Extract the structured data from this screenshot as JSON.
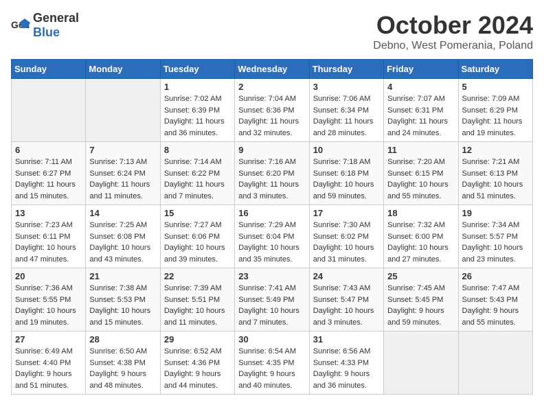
{
  "logo": {
    "general": "General",
    "blue": "Blue"
  },
  "title": "October 2024",
  "location": "Debno, West Pomerania, Poland",
  "days_of_week": [
    "Sunday",
    "Monday",
    "Tuesday",
    "Wednesday",
    "Thursday",
    "Friday",
    "Saturday"
  ],
  "weeks": [
    [
      {
        "day": "",
        "empty": true
      },
      {
        "day": "",
        "empty": true
      },
      {
        "day": "1",
        "sunrise": "Sunrise: 7:02 AM",
        "sunset": "Sunset: 6:39 PM",
        "daylight": "Daylight: 11 hours and 36 minutes."
      },
      {
        "day": "2",
        "sunrise": "Sunrise: 7:04 AM",
        "sunset": "Sunset: 6:36 PM",
        "daylight": "Daylight: 11 hours and 32 minutes."
      },
      {
        "day": "3",
        "sunrise": "Sunrise: 7:06 AM",
        "sunset": "Sunset: 6:34 PM",
        "daylight": "Daylight: 11 hours and 28 minutes."
      },
      {
        "day": "4",
        "sunrise": "Sunrise: 7:07 AM",
        "sunset": "Sunset: 6:31 PM",
        "daylight": "Daylight: 11 hours and 24 minutes."
      },
      {
        "day": "5",
        "sunrise": "Sunrise: 7:09 AM",
        "sunset": "Sunset: 6:29 PM",
        "daylight": "Daylight: 11 hours and 19 minutes."
      }
    ],
    [
      {
        "day": "6",
        "sunrise": "Sunrise: 7:11 AM",
        "sunset": "Sunset: 6:27 PM",
        "daylight": "Daylight: 11 hours and 15 minutes."
      },
      {
        "day": "7",
        "sunrise": "Sunrise: 7:13 AM",
        "sunset": "Sunset: 6:24 PM",
        "daylight": "Daylight: 11 hours and 11 minutes."
      },
      {
        "day": "8",
        "sunrise": "Sunrise: 7:14 AM",
        "sunset": "Sunset: 6:22 PM",
        "daylight": "Daylight: 11 hours and 7 minutes."
      },
      {
        "day": "9",
        "sunrise": "Sunrise: 7:16 AM",
        "sunset": "Sunset: 6:20 PM",
        "daylight": "Daylight: 11 hours and 3 minutes."
      },
      {
        "day": "10",
        "sunrise": "Sunrise: 7:18 AM",
        "sunset": "Sunset: 6:18 PM",
        "daylight": "Daylight: 10 hours and 59 minutes."
      },
      {
        "day": "11",
        "sunrise": "Sunrise: 7:20 AM",
        "sunset": "Sunset: 6:15 PM",
        "daylight": "Daylight: 10 hours and 55 minutes."
      },
      {
        "day": "12",
        "sunrise": "Sunrise: 7:21 AM",
        "sunset": "Sunset: 6:13 PM",
        "daylight": "Daylight: 10 hours and 51 minutes."
      }
    ],
    [
      {
        "day": "13",
        "sunrise": "Sunrise: 7:23 AM",
        "sunset": "Sunset: 6:11 PM",
        "daylight": "Daylight: 10 hours and 47 minutes."
      },
      {
        "day": "14",
        "sunrise": "Sunrise: 7:25 AM",
        "sunset": "Sunset: 6:08 PM",
        "daylight": "Daylight: 10 hours and 43 minutes."
      },
      {
        "day": "15",
        "sunrise": "Sunrise: 7:27 AM",
        "sunset": "Sunset: 6:06 PM",
        "daylight": "Daylight: 10 hours and 39 minutes."
      },
      {
        "day": "16",
        "sunrise": "Sunrise: 7:29 AM",
        "sunset": "Sunset: 6:04 PM",
        "daylight": "Daylight: 10 hours and 35 minutes."
      },
      {
        "day": "17",
        "sunrise": "Sunrise: 7:30 AM",
        "sunset": "Sunset: 6:02 PM",
        "daylight": "Daylight: 10 hours and 31 minutes."
      },
      {
        "day": "18",
        "sunrise": "Sunrise: 7:32 AM",
        "sunset": "Sunset: 6:00 PM",
        "daylight": "Daylight: 10 hours and 27 minutes."
      },
      {
        "day": "19",
        "sunrise": "Sunrise: 7:34 AM",
        "sunset": "Sunset: 5:57 PM",
        "daylight": "Daylight: 10 hours and 23 minutes."
      }
    ],
    [
      {
        "day": "20",
        "sunrise": "Sunrise: 7:36 AM",
        "sunset": "Sunset: 5:55 PM",
        "daylight": "Daylight: 10 hours and 19 minutes."
      },
      {
        "day": "21",
        "sunrise": "Sunrise: 7:38 AM",
        "sunset": "Sunset: 5:53 PM",
        "daylight": "Daylight: 10 hours and 15 minutes."
      },
      {
        "day": "22",
        "sunrise": "Sunrise: 7:39 AM",
        "sunset": "Sunset: 5:51 PM",
        "daylight": "Daylight: 10 hours and 11 minutes."
      },
      {
        "day": "23",
        "sunrise": "Sunrise: 7:41 AM",
        "sunset": "Sunset: 5:49 PM",
        "daylight": "Daylight: 10 hours and 7 minutes."
      },
      {
        "day": "24",
        "sunrise": "Sunrise: 7:43 AM",
        "sunset": "Sunset: 5:47 PM",
        "daylight": "Daylight: 10 hours and 3 minutes."
      },
      {
        "day": "25",
        "sunrise": "Sunrise: 7:45 AM",
        "sunset": "Sunset: 5:45 PM",
        "daylight": "Daylight: 9 hours and 59 minutes."
      },
      {
        "day": "26",
        "sunrise": "Sunrise: 7:47 AM",
        "sunset": "Sunset: 5:43 PM",
        "daylight": "Daylight: 9 hours and 55 minutes."
      }
    ],
    [
      {
        "day": "27",
        "sunrise": "Sunrise: 6:49 AM",
        "sunset": "Sunset: 4:40 PM",
        "daylight": "Daylight: 9 hours and 51 minutes."
      },
      {
        "day": "28",
        "sunrise": "Sunrise: 6:50 AM",
        "sunset": "Sunset: 4:38 PM",
        "daylight": "Daylight: 9 hours and 48 minutes."
      },
      {
        "day": "29",
        "sunrise": "Sunrise: 6:52 AM",
        "sunset": "Sunset: 4:36 PM",
        "daylight": "Daylight: 9 hours and 44 minutes."
      },
      {
        "day": "30",
        "sunrise": "Sunrise: 6:54 AM",
        "sunset": "Sunset: 4:35 PM",
        "daylight": "Daylight: 9 hours and 40 minutes."
      },
      {
        "day": "31",
        "sunrise": "Sunrise: 6:56 AM",
        "sunset": "Sunset: 4:33 PM",
        "daylight": "Daylight: 9 hours and 36 minutes."
      },
      {
        "day": "",
        "empty": true
      },
      {
        "day": "",
        "empty": true
      }
    ]
  ]
}
